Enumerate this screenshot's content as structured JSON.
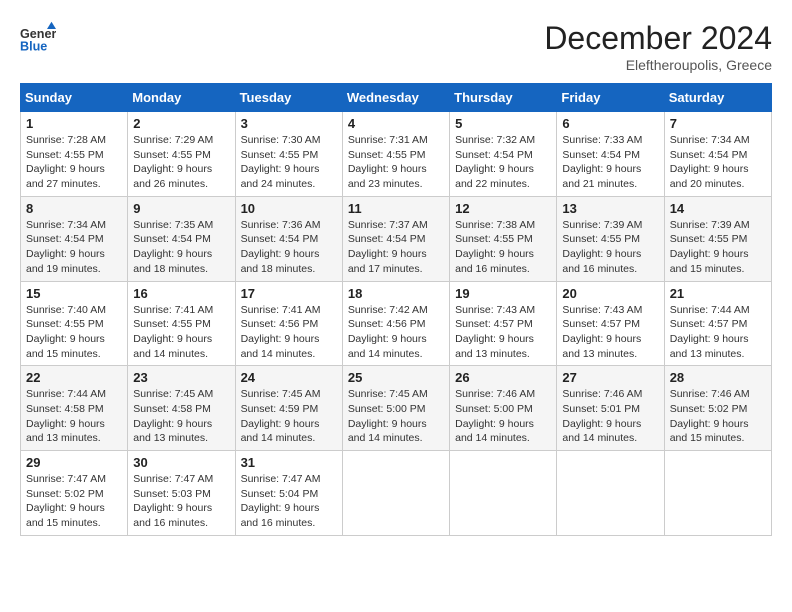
{
  "header": {
    "logo_line1": "General",
    "logo_line2": "Blue",
    "month": "December 2024",
    "location": "Eleftheroupolis, Greece"
  },
  "weekdays": [
    "Sunday",
    "Monday",
    "Tuesday",
    "Wednesday",
    "Thursday",
    "Friday",
    "Saturday"
  ],
  "weeks": [
    [
      {
        "day": "1",
        "sunrise": "7:28 AM",
        "sunset": "4:55 PM",
        "daylight": "9 hours and 27 minutes."
      },
      {
        "day": "2",
        "sunrise": "7:29 AM",
        "sunset": "4:55 PM",
        "daylight": "9 hours and 26 minutes."
      },
      {
        "day": "3",
        "sunrise": "7:30 AM",
        "sunset": "4:55 PM",
        "daylight": "9 hours and 24 minutes."
      },
      {
        "day": "4",
        "sunrise": "7:31 AM",
        "sunset": "4:55 PM",
        "daylight": "9 hours and 23 minutes."
      },
      {
        "day": "5",
        "sunrise": "7:32 AM",
        "sunset": "4:54 PM",
        "daylight": "9 hours and 22 minutes."
      },
      {
        "day": "6",
        "sunrise": "7:33 AM",
        "sunset": "4:54 PM",
        "daylight": "9 hours and 21 minutes."
      },
      {
        "day": "7",
        "sunrise": "7:34 AM",
        "sunset": "4:54 PM",
        "daylight": "9 hours and 20 minutes."
      }
    ],
    [
      {
        "day": "8",
        "sunrise": "7:34 AM",
        "sunset": "4:54 PM",
        "daylight": "9 hours and 19 minutes."
      },
      {
        "day": "9",
        "sunrise": "7:35 AM",
        "sunset": "4:54 PM",
        "daylight": "9 hours and 18 minutes."
      },
      {
        "day": "10",
        "sunrise": "7:36 AM",
        "sunset": "4:54 PM",
        "daylight": "9 hours and 18 minutes."
      },
      {
        "day": "11",
        "sunrise": "7:37 AM",
        "sunset": "4:54 PM",
        "daylight": "9 hours and 17 minutes."
      },
      {
        "day": "12",
        "sunrise": "7:38 AM",
        "sunset": "4:55 PM",
        "daylight": "9 hours and 16 minutes."
      },
      {
        "day": "13",
        "sunrise": "7:39 AM",
        "sunset": "4:55 PM",
        "daylight": "9 hours and 16 minutes."
      },
      {
        "day": "14",
        "sunrise": "7:39 AM",
        "sunset": "4:55 PM",
        "daylight": "9 hours and 15 minutes."
      }
    ],
    [
      {
        "day": "15",
        "sunrise": "7:40 AM",
        "sunset": "4:55 PM",
        "daylight": "9 hours and 15 minutes."
      },
      {
        "day": "16",
        "sunrise": "7:41 AM",
        "sunset": "4:55 PM",
        "daylight": "9 hours and 14 minutes."
      },
      {
        "day": "17",
        "sunrise": "7:41 AM",
        "sunset": "4:56 PM",
        "daylight": "9 hours and 14 minutes."
      },
      {
        "day": "18",
        "sunrise": "7:42 AM",
        "sunset": "4:56 PM",
        "daylight": "9 hours and 14 minutes."
      },
      {
        "day": "19",
        "sunrise": "7:43 AM",
        "sunset": "4:57 PM",
        "daylight": "9 hours and 13 minutes."
      },
      {
        "day": "20",
        "sunrise": "7:43 AM",
        "sunset": "4:57 PM",
        "daylight": "9 hours and 13 minutes."
      },
      {
        "day": "21",
        "sunrise": "7:44 AM",
        "sunset": "4:57 PM",
        "daylight": "9 hours and 13 minutes."
      }
    ],
    [
      {
        "day": "22",
        "sunrise": "7:44 AM",
        "sunset": "4:58 PM",
        "daylight": "9 hours and 13 minutes."
      },
      {
        "day": "23",
        "sunrise": "7:45 AM",
        "sunset": "4:58 PM",
        "daylight": "9 hours and 13 minutes."
      },
      {
        "day": "24",
        "sunrise": "7:45 AM",
        "sunset": "4:59 PM",
        "daylight": "9 hours and 14 minutes."
      },
      {
        "day": "25",
        "sunrise": "7:45 AM",
        "sunset": "5:00 PM",
        "daylight": "9 hours and 14 minutes."
      },
      {
        "day": "26",
        "sunrise": "7:46 AM",
        "sunset": "5:00 PM",
        "daylight": "9 hours and 14 minutes."
      },
      {
        "day": "27",
        "sunrise": "7:46 AM",
        "sunset": "5:01 PM",
        "daylight": "9 hours and 14 minutes."
      },
      {
        "day": "28",
        "sunrise": "7:46 AM",
        "sunset": "5:02 PM",
        "daylight": "9 hours and 15 minutes."
      }
    ],
    [
      {
        "day": "29",
        "sunrise": "7:47 AM",
        "sunset": "5:02 PM",
        "daylight": "9 hours and 15 minutes."
      },
      {
        "day": "30",
        "sunrise": "7:47 AM",
        "sunset": "5:03 PM",
        "daylight": "9 hours and 16 minutes."
      },
      {
        "day": "31",
        "sunrise": "7:47 AM",
        "sunset": "5:04 PM",
        "daylight": "9 hours and 16 minutes."
      },
      null,
      null,
      null,
      null
    ]
  ],
  "labels": {
    "sunrise": "Sunrise:",
    "sunset": "Sunset:",
    "daylight": "Daylight:"
  }
}
